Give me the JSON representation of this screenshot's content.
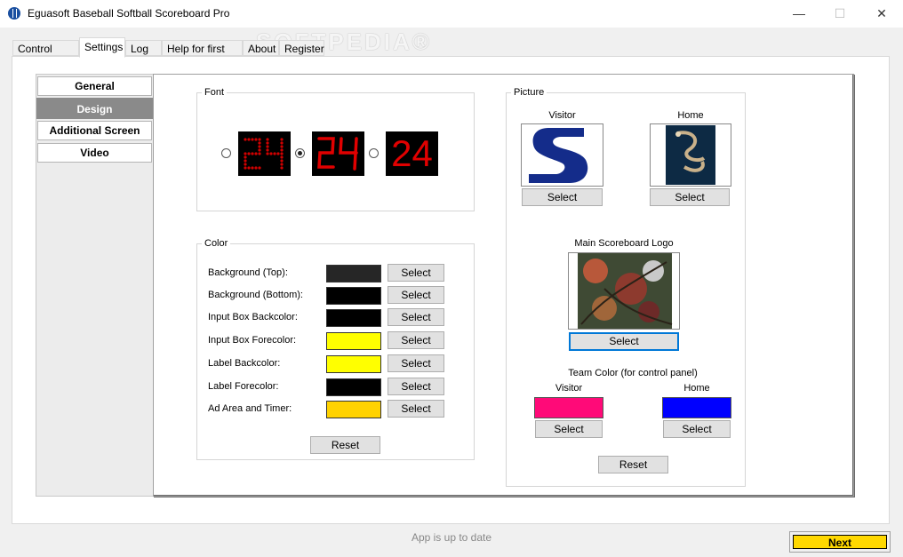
{
  "window": {
    "title": "Eguasoft Baseball Softball Scoreboard Pro",
    "minimize_glyph": "—",
    "maximize_glyph": "☐",
    "close_glyph": "✕",
    "watermark": "SOFTPEDIA®"
  },
  "tabs": [
    {
      "label": "Control Panel",
      "active": false
    },
    {
      "label": "Settings",
      "active": true
    },
    {
      "label": "Log",
      "active": false
    },
    {
      "label": "Help for first step",
      "active": false
    },
    {
      "label": "About",
      "active": false
    },
    {
      "label": "Register",
      "active": false
    }
  ],
  "settings_nav": [
    {
      "label": "General",
      "selected": false
    },
    {
      "label": "Design",
      "selected": true
    },
    {
      "label": "Additional Screen",
      "selected": false
    },
    {
      "label": "Video",
      "selected": false
    }
  ],
  "font_group": {
    "legend": "Font",
    "options": [
      {
        "sample": "24",
        "style": "dot-matrix",
        "checked": false
      },
      {
        "sample": "24",
        "style": "segment",
        "checked": true
      },
      {
        "sample": "24",
        "style": "plain",
        "checked": false
      }
    ],
    "digit_color": "#e00000"
  },
  "color_group": {
    "legend": "Color",
    "rows": [
      {
        "label": "Background (Top):",
        "color": "#262626",
        "button": "Select"
      },
      {
        "label": "Background (Bottom):",
        "color": "#000000",
        "button": "Select"
      },
      {
        "label": "Input Box Backcolor:",
        "color": "#000000",
        "button": "Select"
      },
      {
        "label": "Input Box Forecolor:",
        "color": "#ffff00",
        "button": "Select"
      },
      {
        "label": "Label Backcolor:",
        "color": "#ffff00",
        "button": "Select"
      },
      {
        "label": "Label Forecolor:",
        "color": "#000000",
        "button": "Select"
      },
      {
        "label": "Ad Area and Timer:",
        "color": "#ffd200",
        "button": "Select"
      }
    ],
    "reset_label": "Reset"
  },
  "picture_group": {
    "legend": "Picture",
    "visitor_label": "Visitor",
    "home_label": "Home",
    "visitor_select": "Select",
    "home_select": "Select",
    "main_logo_label": "Main Scoreboard Logo",
    "main_logo_select": "Select",
    "team_color_label": "Team Color (for control panel)",
    "team_visitor_label": "Visitor",
    "team_home_label": "Home",
    "team_visitor_color": "#ff0a78",
    "team_home_color": "#0000ff",
    "team_visitor_select": "Select",
    "team_home_select": "Select",
    "reset_label": "Reset"
  },
  "status": "App is up to date",
  "next_label": "Next",
  "colors": {
    "accent_focus": "#0078d7",
    "next_button": "#ffd800",
    "selected_nav": "#8a8a8a"
  }
}
